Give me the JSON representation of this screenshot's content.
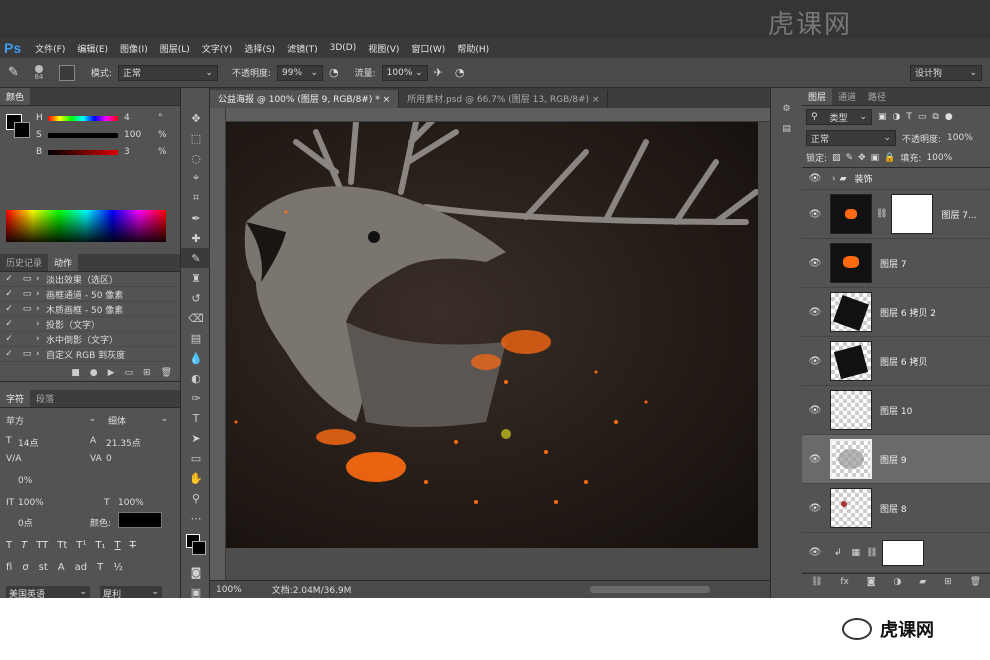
{
  "app": {
    "logo": "Ps"
  },
  "menu": [
    "文件(F)",
    "编辑(E)",
    "图像(I)",
    "图层(L)",
    "文字(Y)",
    "选择(S)",
    "滤镜(T)",
    "3D(D)",
    "视图(V)",
    "窗口(W)",
    "帮助(H)"
  ],
  "options": {
    "brush_size": "84",
    "mode_label": "模式:",
    "mode_value": "正常",
    "opacity_label": "不透明度:",
    "opacity_value": "99%",
    "flow_label": "流量:",
    "flow_value": "100%",
    "workspace": "设计狗"
  },
  "color_panel": {
    "tabs": [
      "颜色"
    ],
    "h_label": "H",
    "h_value": "4",
    "h_unit": "°",
    "s_label": "S",
    "s_value": "100",
    "s_unit": "%",
    "b_label": "B",
    "b_value": "3",
    "b_unit": "%"
  },
  "history_panel": {
    "tabs": [
      "历史记录",
      "动作"
    ],
    "items": [
      "淡出效果（选区）",
      "画框通道 - 50 像素",
      "木质画框 - 50 像素",
      "投影（文字）",
      "水中倒影（文字）",
      "自定义 RGB 到灰度"
    ]
  },
  "char_panel": {
    "tabs": [
      "字符",
      "段落"
    ],
    "font_family": "苹方",
    "font_style": "细体",
    "font_size": "14点",
    "leading": "21.35点",
    "kerning": "V/A",
    "tracking": "0",
    "scale_pct": "0%",
    "vscale": "100%",
    "hscale": "100%",
    "baseline": "0点",
    "color_label": "颜色:",
    "language": "美国英语",
    "aa_mode": "犀利"
  },
  "document": {
    "tabs": [
      "公益海报 @ 100% (图层 9, RGB/8#) *",
      "所用素材.psd @ 66.7% (图层 13, RGB/8#)"
    ],
    "zoom": "100%",
    "doc_info": "文档:2.04M/36.9M"
  },
  "layers_panel": {
    "tabs": [
      "图层",
      "通道",
      "路径"
    ],
    "filter_kind": "类型",
    "blend_mode": "正常",
    "opacity_label": "不透明度:",
    "opacity_value": "100%",
    "lock_label": "锁定:",
    "fill_label": "填充:",
    "fill_value": "100%",
    "group_name": "装饰",
    "layers": [
      "图层 7...",
      "图层 7",
      "图层 6 拷贝 2",
      "图层 6 拷贝",
      "图层 10",
      "图层 9",
      "图层 8"
    ]
  },
  "watermark": "虎课网",
  "colors": {
    "accent": "#3d9cf0",
    "selected_layer": "#6a6a6a",
    "fire": "#ff6a10"
  }
}
